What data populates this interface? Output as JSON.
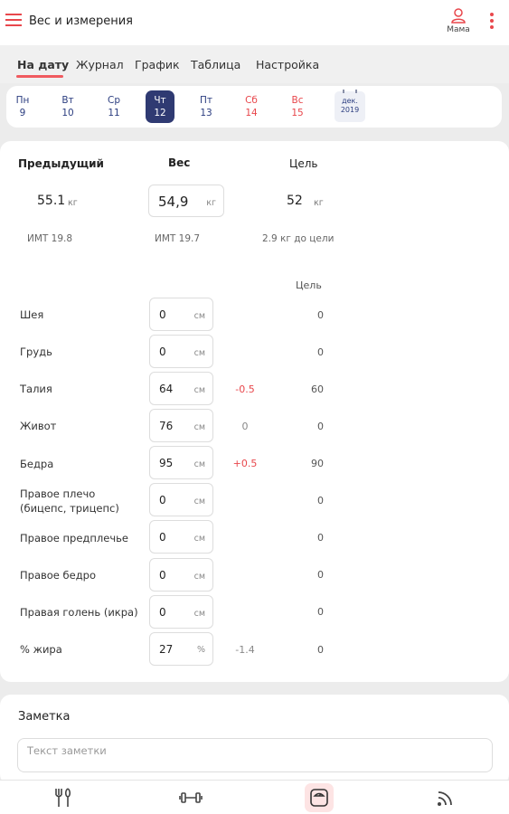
{
  "app": {
    "title": "Вес и измерения",
    "user": "Мама"
  },
  "tabs": [
    "На дату",
    "Журнал",
    "График",
    "Таблица",
    "Настройка"
  ],
  "week": [
    {
      "dow": "Пн",
      "date": "9"
    },
    {
      "dow": "Вт",
      "date": "10"
    },
    {
      "dow": "Ср",
      "date": "11"
    },
    {
      "dow": "Чт",
      "date": "12"
    },
    {
      "dow": "Пт",
      "date": "13"
    },
    {
      "dow": "Сб",
      "date": "14"
    },
    {
      "dow": "Вс",
      "date": "15"
    }
  ],
  "calendar": {
    "month": "дек.",
    "year": "2019"
  },
  "summary": {
    "previous_label": "Предыдущий",
    "weight_label": "Вес",
    "goal_label": "Цель",
    "previous_value": "55.1",
    "weight_value": "54,9",
    "goal_value": "52",
    "unit": "кг",
    "previous_bmi": "ИМТ 19.8",
    "current_bmi": "ИМТ 19.7",
    "to_goal": "2.9 кг до цели"
  },
  "measures_goal_header": "Цель",
  "measures": [
    {
      "label": "Шея",
      "value": "0",
      "unit": "см",
      "diff": "",
      "goal": "0"
    },
    {
      "label": "Грудь",
      "value": "0",
      "unit": "см",
      "diff": "",
      "goal": "0"
    },
    {
      "label": "Талия",
      "value": "64",
      "unit": "см",
      "diff": "-0.5",
      "goal": "60"
    },
    {
      "label": "Живот",
      "value": "76",
      "unit": "см",
      "diff": "0",
      "goal": "0"
    },
    {
      "label": "Бедра",
      "value": "95",
      "unit": "см",
      "diff": "+0.5",
      "goal": "90"
    },
    {
      "label": "Правое плечо",
      "label2": "(бицепс, трицепс)",
      "value": "0",
      "unit": "см",
      "diff": "",
      "goal": "0"
    },
    {
      "label": "Правое предплечье",
      "value": "0",
      "unit": "см",
      "diff": "",
      "goal": "0"
    },
    {
      "label": "Правое бедро",
      "value": "0",
      "unit": "см",
      "diff": "",
      "goal": "0"
    },
    {
      "label": "Правая голень (икра)",
      "value": "0",
      "unit": "см",
      "diff": "",
      "goal": "0"
    },
    {
      "label": "% жира",
      "value": "27",
      "unit": "%",
      "diff": "-1.4",
      "goal": "0"
    }
  ],
  "note": {
    "title": "Заметка",
    "placeholder": "Текст заметки"
  },
  "colors": {
    "accent": "#e8474c",
    "selected_day": "#2f3a72",
    "background": "#ececec"
  },
  "nav": [
    "food-icon",
    "dumbbell-icon",
    "scale-icon",
    "rss-icon"
  ]
}
